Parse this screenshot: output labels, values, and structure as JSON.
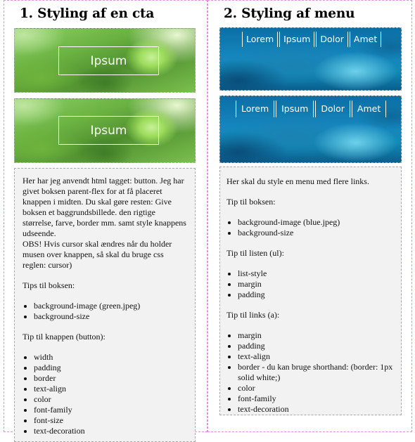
{
  "left": {
    "title": "1. Styling af en cta",
    "button1": "Ipsum",
    "button2": "Ipsum",
    "intro": "Her har jeg anvendt html tagget: button. Jeg har givet boksen parent-flex for at få placeret knappen i midten. Du skal gøre resten: Give boksen et baggrundsbillede. den rigtige størrelse, farve, border mm. samt style knappens udseende.",
    "obs": "OBS! Hvis cursor skal ændres når du holder musen over knappen, så skal du bruge css reglen: cursor)",
    "tips_box_heading": "Tips til boksen:",
    "tips_box": [
      "background-image (green.jpeg)",
      "background-size"
    ],
    "tips_button_heading": "Tip til knappen (button):",
    "tips_button": [
      "width",
      "padding",
      "border",
      "text-align",
      "color",
      "font-family",
      "font-size",
      "text-decoration"
    ]
  },
  "right": {
    "title": "2. Styling af menu",
    "menu1": [
      "Lorem",
      "Ipsum",
      "Dolor",
      "Amet"
    ],
    "menu2": [
      "Lorem",
      "Ipsum",
      "Dolor",
      "Amet"
    ],
    "intro": "Her skal du style en menu med flere links.",
    "tips_box_heading": "Tip til boksen:",
    "tips_box": [
      "background-image (blue.jpeg)",
      "background-size"
    ],
    "tips_list_heading": "Tip til listen (ul):",
    "tips_list": [
      "list-style",
      "margin",
      "padding"
    ],
    "tips_links_heading": "Tip til links (a):",
    "tips_links": [
      "margin",
      "padding",
      "text-align",
      "border - du kan bruge shorthand: (border: 1px solid white;)",
      "color",
      "font-family",
      "text-decoration"
    ]
  },
  "colors": {
    "column_border": "#e08ee0",
    "textbox_bg": "#f2f2f2",
    "button_text": "#ffffff"
  }
}
